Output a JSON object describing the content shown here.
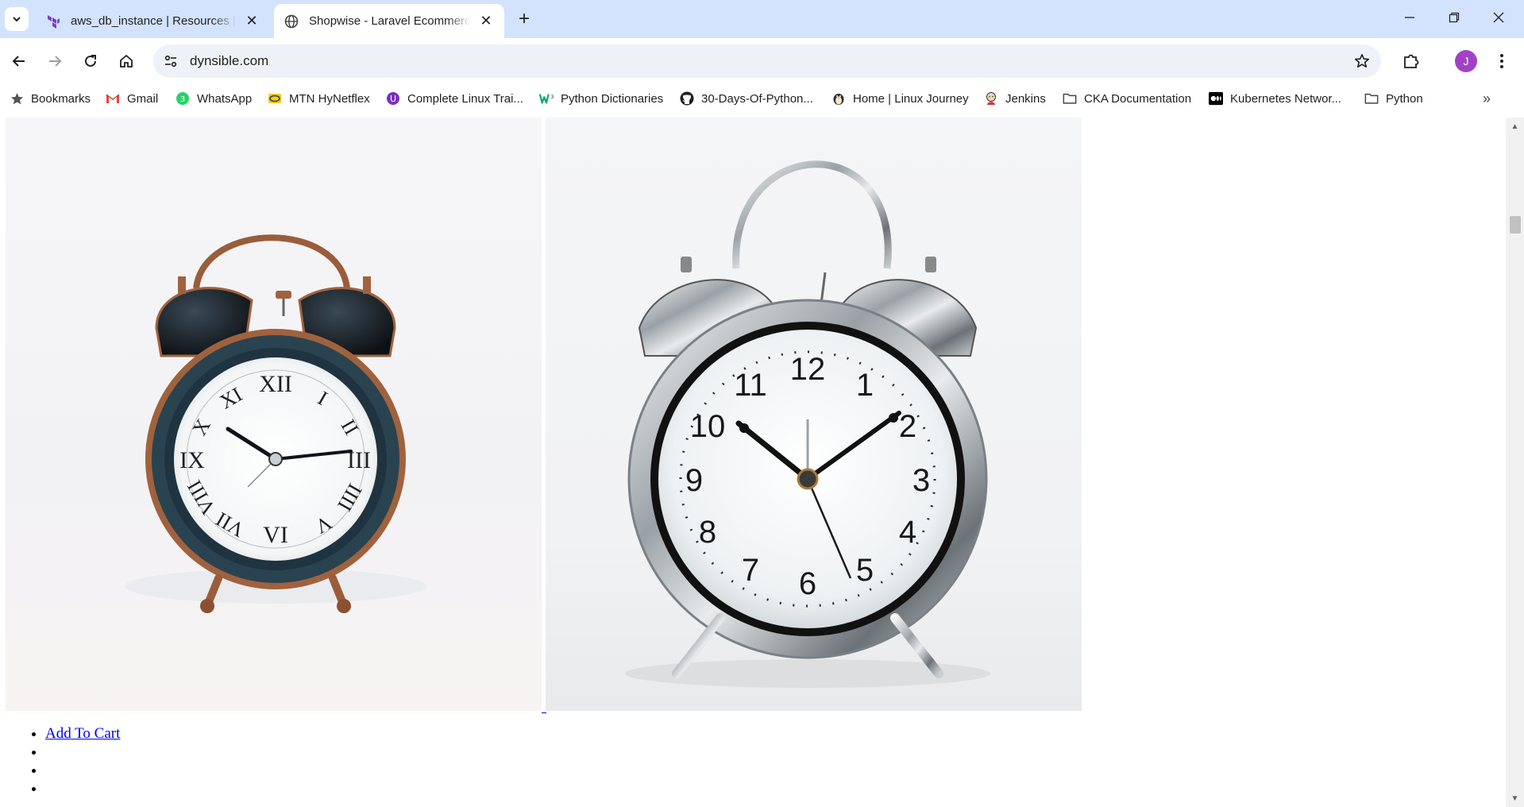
{
  "browser": {
    "tabs": [
      {
        "title": "aws_db_instance | Resources | h",
        "favicon": "terraform-icon",
        "active": false
      },
      {
        "title": "Shopwise - Laravel Ecommerce",
        "favicon": "globe-icon",
        "active": true
      }
    ],
    "address": "dynsible.com",
    "profile_initial": "J",
    "accent": "#d3e3fd"
  },
  "bookmarks": [
    {
      "label": "Bookmarks",
      "icon": "star-icon"
    },
    {
      "label": "Gmail",
      "icon": "gmail-icon"
    },
    {
      "label": "WhatsApp",
      "icon": "whatsapp-icon"
    },
    {
      "label": "MTN HyNetflex",
      "icon": "mtn-icon"
    },
    {
      "label": "Complete Linux Trai...",
      "icon": "course-icon"
    },
    {
      "label": "Python Dictionaries",
      "icon": "w3-icon"
    },
    {
      "label": "30-Days-Of-Python...",
      "icon": "github-icon"
    },
    {
      "label": "Home | Linux Journey",
      "icon": "penguin-icon"
    },
    {
      "label": "Jenkins",
      "icon": "jenkins-icon"
    },
    {
      "label": "CKA Documentation",
      "icon": "folder-icon"
    },
    {
      "label": "Kubernetes Networ...",
      "icon": "medium-icon"
    },
    {
      "label": "Python",
      "icon": "folder-icon"
    }
  ],
  "page": {
    "images": [
      {
        "name": "vintage-copper-alarm-clock",
        "dial": "roman"
      },
      {
        "name": "silver-chrome-alarm-clock",
        "dial": "arabic"
      }
    ],
    "list_items": [
      "Add To Cart",
      "",
      "",
      ""
    ]
  }
}
